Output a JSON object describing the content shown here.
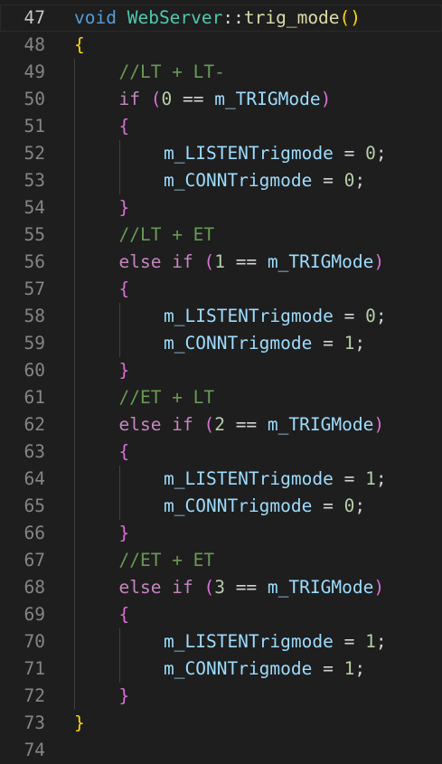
{
  "editor": {
    "lines": [
      {
        "n": "47",
        "current": true,
        "indent": 0,
        "tokens": [
          {
            "t": "void",
            "c": "kw"
          },
          {
            "t": " ",
            "c": "op"
          },
          {
            "t": "WebServer",
            "c": "cls"
          },
          {
            "t": "::",
            "c": "op"
          },
          {
            "t": "trig_mode",
            "c": "fn"
          },
          {
            "t": "()",
            "c": "b1"
          }
        ]
      },
      {
        "n": "48",
        "indent": 0,
        "tokens": [
          {
            "t": "{",
            "c": "b1"
          }
        ]
      },
      {
        "n": "49",
        "indent": 1,
        "tokens": [
          {
            "t": "//LT + LT-",
            "c": "cmt"
          }
        ]
      },
      {
        "n": "50",
        "indent": 1,
        "tokens": [
          {
            "t": "if",
            "c": "ctl"
          },
          {
            "t": " ",
            "c": "op"
          },
          {
            "t": "(",
            "c": "b2"
          },
          {
            "t": "0",
            "c": "num"
          },
          {
            "t": " == ",
            "c": "op"
          },
          {
            "t": "m_TRIGMode",
            "c": "var"
          },
          {
            "t": ")",
            "c": "b2"
          }
        ]
      },
      {
        "n": "51",
        "indent": 1,
        "tokens": [
          {
            "t": "{",
            "c": "b2"
          }
        ]
      },
      {
        "n": "52",
        "indent": 2,
        "tokens": [
          {
            "t": "m_LISTENTrigmode",
            "c": "var"
          },
          {
            "t": " = ",
            "c": "op"
          },
          {
            "t": "0",
            "c": "num"
          },
          {
            "t": ";",
            "c": "op"
          }
        ]
      },
      {
        "n": "53",
        "indent": 2,
        "tokens": [
          {
            "t": "m_CONNTrigmode",
            "c": "var"
          },
          {
            "t": " = ",
            "c": "op"
          },
          {
            "t": "0",
            "c": "num"
          },
          {
            "t": ";",
            "c": "op"
          }
        ]
      },
      {
        "n": "54",
        "indent": 1,
        "tokens": [
          {
            "t": "}",
            "c": "b2"
          }
        ]
      },
      {
        "n": "55",
        "indent": 1,
        "tokens": [
          {
            "t": "//LT + ET",
            "c": "cmt"
          }
        ]
      },
      {
        "n": "56",
        "indent": 1,
        "tokens": [
          {
            "t": "else",
            "c": "ctl"
          },
          {
            "t": " ",
            "c": "op"
          },
          {
            "t": "if",
            "c": "ctl"
          },
          {
            "t": " ",
            "c": "op"
          },
          {
            "t": "(",
            "c": "b2"
          },
          {
            "t": "1",
            "c": "num"
          },
          {
            "t": " == ",
            "c": "op"
          },
          {
            "t": "m_TRIGMode",
            "c": "var"
          },
          {
            "t": ")",
            "c": "b2"
          }
        ]
      },
      {
        "n": "57",
        "indent": 1,
        "tokens": [
          {
            "t": "{",
            "c": "b2"
          }
        ]
      },
      {
        "n": "58",
        "indent": 2,
        "tokens": [
          {
            "t": "m_LISTENTrigmode",
            "c": "var"
          },
          {
            "t": " = ",
            "c": "op"
          },
          {
            "t": "0",
            "c": "num"
          },
          {
            "t": ";",
            "c": "op"
          }
        ]
      },
      {
        "n": "59",
        "indent": 2,
        "tokens": [
          {
            "t": "m_CONNTrigmode",
            "c": "var"
          },
          {
            "t": " = ",
            "c": "op"
          },
          {
            "t": "1",
            "c": "num"
          },
          {
            "t": ";",
            "c": "op"
          }
        ]
      },
      {
        "n": "60",
        "indent": 1,
        "tokens": [
          {
            "t": "}",
            "c": "b2"
          }
        ]
      },
      {
        "n": "61",
        "indent": 1,
        "tokens": [
          {
            "t": "//ET + LT",
            "c": "cmt"
          }
        ]
      },
      {
        "n": "62",
        "indent": 1,
        "tokens": [
          {
            "t": "else",
            "c": "ctl"
          },
          {
            "t": " ",
            "c": "op"
          },
          {
            "t": "if",
            "c": "ctl"
          },
          {
            "t": " ",
            "c": "op"
          },
          {
            "t": "(",
            "c": "b2"
          },
          {
            "t": "2",
            "c": "num"
          },
          {
            "t": " == ",
            "c": "op"
          },
          {
            "t": "m_TRIGMode",
            "c": "var"
          },
          {
            "t": ")",
            "c": "b2"
          }
        ]
      },
      {
        "n": "63",
        "indent": 1,
        "tokens": [
          {
            "t": "{",
            "c": "b2"
          }
        ]
      },
      {
        "n": "64",
        "indent": 2,
        "tokens": [
          {
            "t": "m_LISTENTrigmode",
            "c": "var"
          },
          {
            "t": " = ",
            "c": "op"
          },
          {
            "t": "1",
            "c": "num"
          },
          {
            "t": ";",
            "c": "op"
          }
        ]
      },
      {
        "n": "65",
        "indent": 2,
        "tokens": [
          {
            "t": "m_CONNTrigmode",
            "c": "var"
          },
          {
            "t": " = ",
            "c": "op"
          },
          {
            "t": "0",
            "c": "num"
          },
          {
            "t": ";",
            "c": "op"
          }
        ]
      },
      {
        "n": "66",
        "indent": 1,
        "tokens": [
          {
            "t": "}",
            "c": "b2"
          }
        ]
      },
      {
        "n": "67",
        "indent": 1,
        "tokens": [
          {
            "t": "//ET + ET",
            "c": "cmt"
          }
        ]
      },
      {
        "n": "68",
        "indent": 1,
        "tokens": [
          {
            "t": "else",
            "c": "ctl"
          },
          {
            "t": " ",
            "c": "op"
          },
          {
            "t": "if",
            "c": "ctl"
          },
          {
            "t": " ",
            "c": "op"
          },
          {
            "t": "(",
            "c": "b2"
          },
          {
            "t": "3",
            "c": "num"
          },
          {
            "t": " == ",
            "c": "op"
          },
          {
            "t": "m_TRIGMode",
            "c": "var"
          },
          {
            "t": ")",
            "c": "b2"
          }
        ]
      },
      {
        "n": "69",
        "indent": 1,
        "tokens": [
          {
            "t": "{",
            "c": "b2"
          }
        ]
      },
      {
        "n": "70",
        "indent": 2,
        "tokens": [
          {
            "t": "m_LISTENTrigmode",
            "c": "var"
          },
          {
            "t": " = ",
            "c": "op"
          },
          {
            "t": "1",
            "c": "num"
          },
          {
            "t": ";",
            "c": "op"
          }
        ]
      },
      {
        "n": "71",
        "indent": 2,
        "tokens": [
          {
            "t": "m_CONNTrigmode",
            "c": "var"
          },
          {
            "t": " = ",
            "c": "op"
          },
          {
            "t": "1",
            "c": "num"
          },
          {
            "t": ";",
            "c": "op"
          }
        ]
      },
      {
        "n": "72",
        "indent": 1,
        "tokens": [
          {
            "t": "}",
            "c": "b2"
          }
        ]
      },
      {
        "n": "73",
        "indent": 0,
        "tokens": [
          {
            "t": "}",
            "c": "b1"
          }
        ]
      },
      {
        "n": "74",
        "indent": 0,
        "tokens": []
      }
    ]
  },
  "colors": {
    "background": "#1e1e1e",
    "keyword": "#569cd6",
    "control": "#c586c0",
    "function": "#dcdcaa",
    "class": "#4ec9b0",
    "variable": "#9cdcfe",
    "number": "#b5cea8",
    "comment": "#6a9955",
    "bracket_level1": "#ffd700",
    "bracket_level2": "#da70d6"
  }
}
